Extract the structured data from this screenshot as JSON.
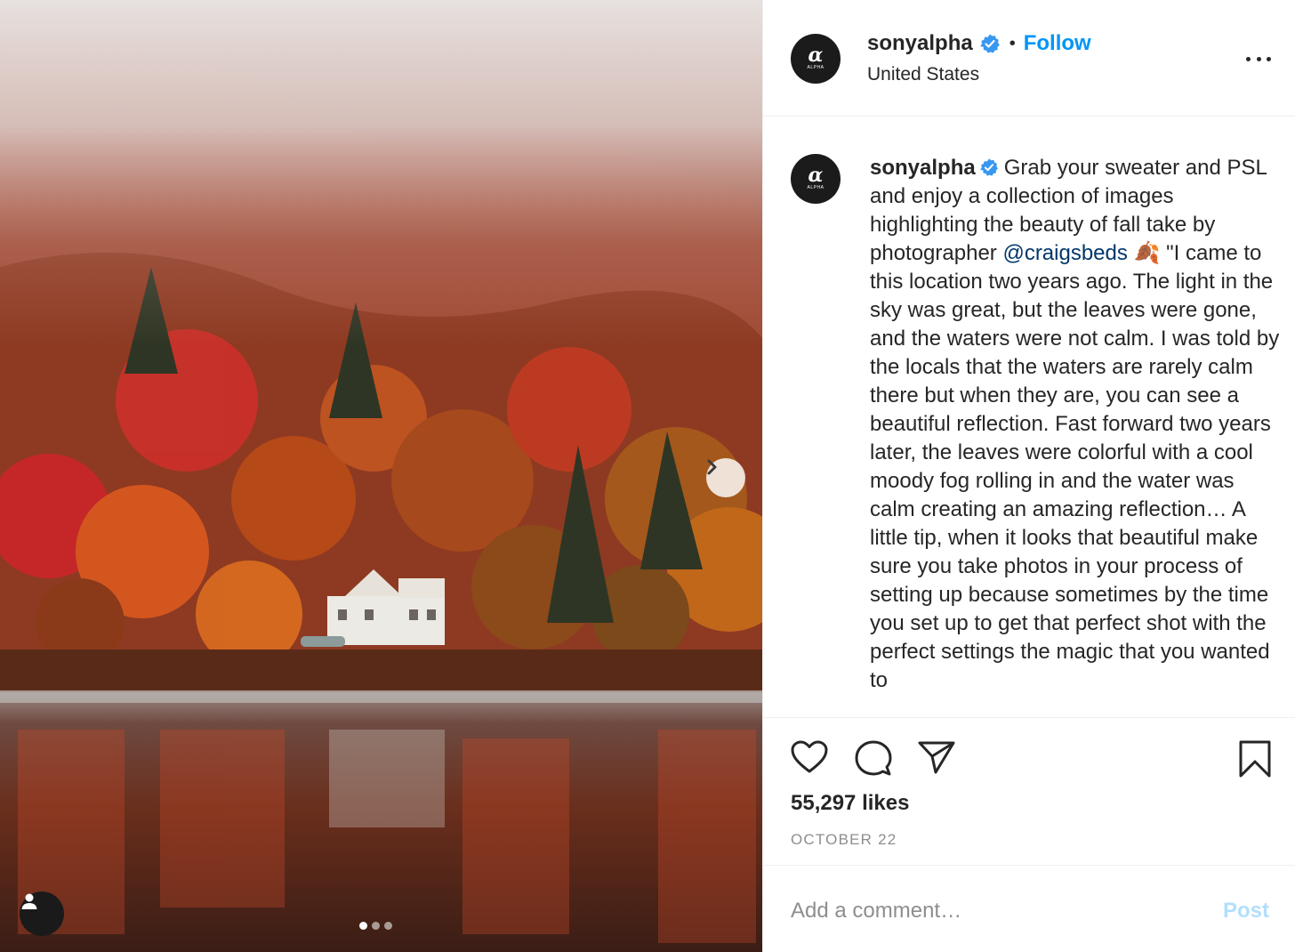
{
  "post": {
    "image_alt": "Autumn forest with a white house reflected in a lake",
    "carousel": {
      "total": 3,
      "active": 1
    },
    "next_icon": "chevron-right-icon",
    "tag_icon": "user-tag-icon"
  },
  "header": {
    "avatar_symbol": "α",
    "avatar_word": "ALPHA",
    "username": "sonyalpha",
    "separator": "•",
    "follow_label": "Follow",
    "location": "United States",
    "more_icon": "more-horizontal-icon"
  },
  "caption": {
    "username": "sonyalpha",
    "text_before_mention": "Grab your sweater and PSL and enjoy a collection of images highlighting the beauty of fall take by photographer ",
    "mention": "@craigsbeds",
    "emoji": "🍂",
    "text_after_mention": " \"I came to this location two years ago. The light in the sky was great, but the leaves were gone, and the waters were not calm. I was told by the locals that the waters are rarely calm there but when they are, you can see a beautiful reflection. Fast forward two years later, the leaves were colorful with a cool moody fog rolling in and the water was calm creating an amazing reflection… A little tip, when it looks that beautiful make sure you take photos in your process of setting up because sometimes by the time you set up to get that perfect shot with the perfect settings the magic that you wanted to"
  },
  "actions": {
    "icons": [
      "heart-icon",
      "comment-icon",
      "share-icon",
      "bookmark-icon"
    ],
    "likes": "55,297 likes",
    "date": "OCTOBER 22"
  },
  "comment": {
    "placeholder": "Add a comment…",
    "post_label": "Post"
  },
  "colors": {
    "accent": "#0095f6",
    "verified": "#3897f0",
    "post_disabled": "#b2dffc",
    "muted": "#8e8e8e",
    "mention": "#00376b"
  }
}
